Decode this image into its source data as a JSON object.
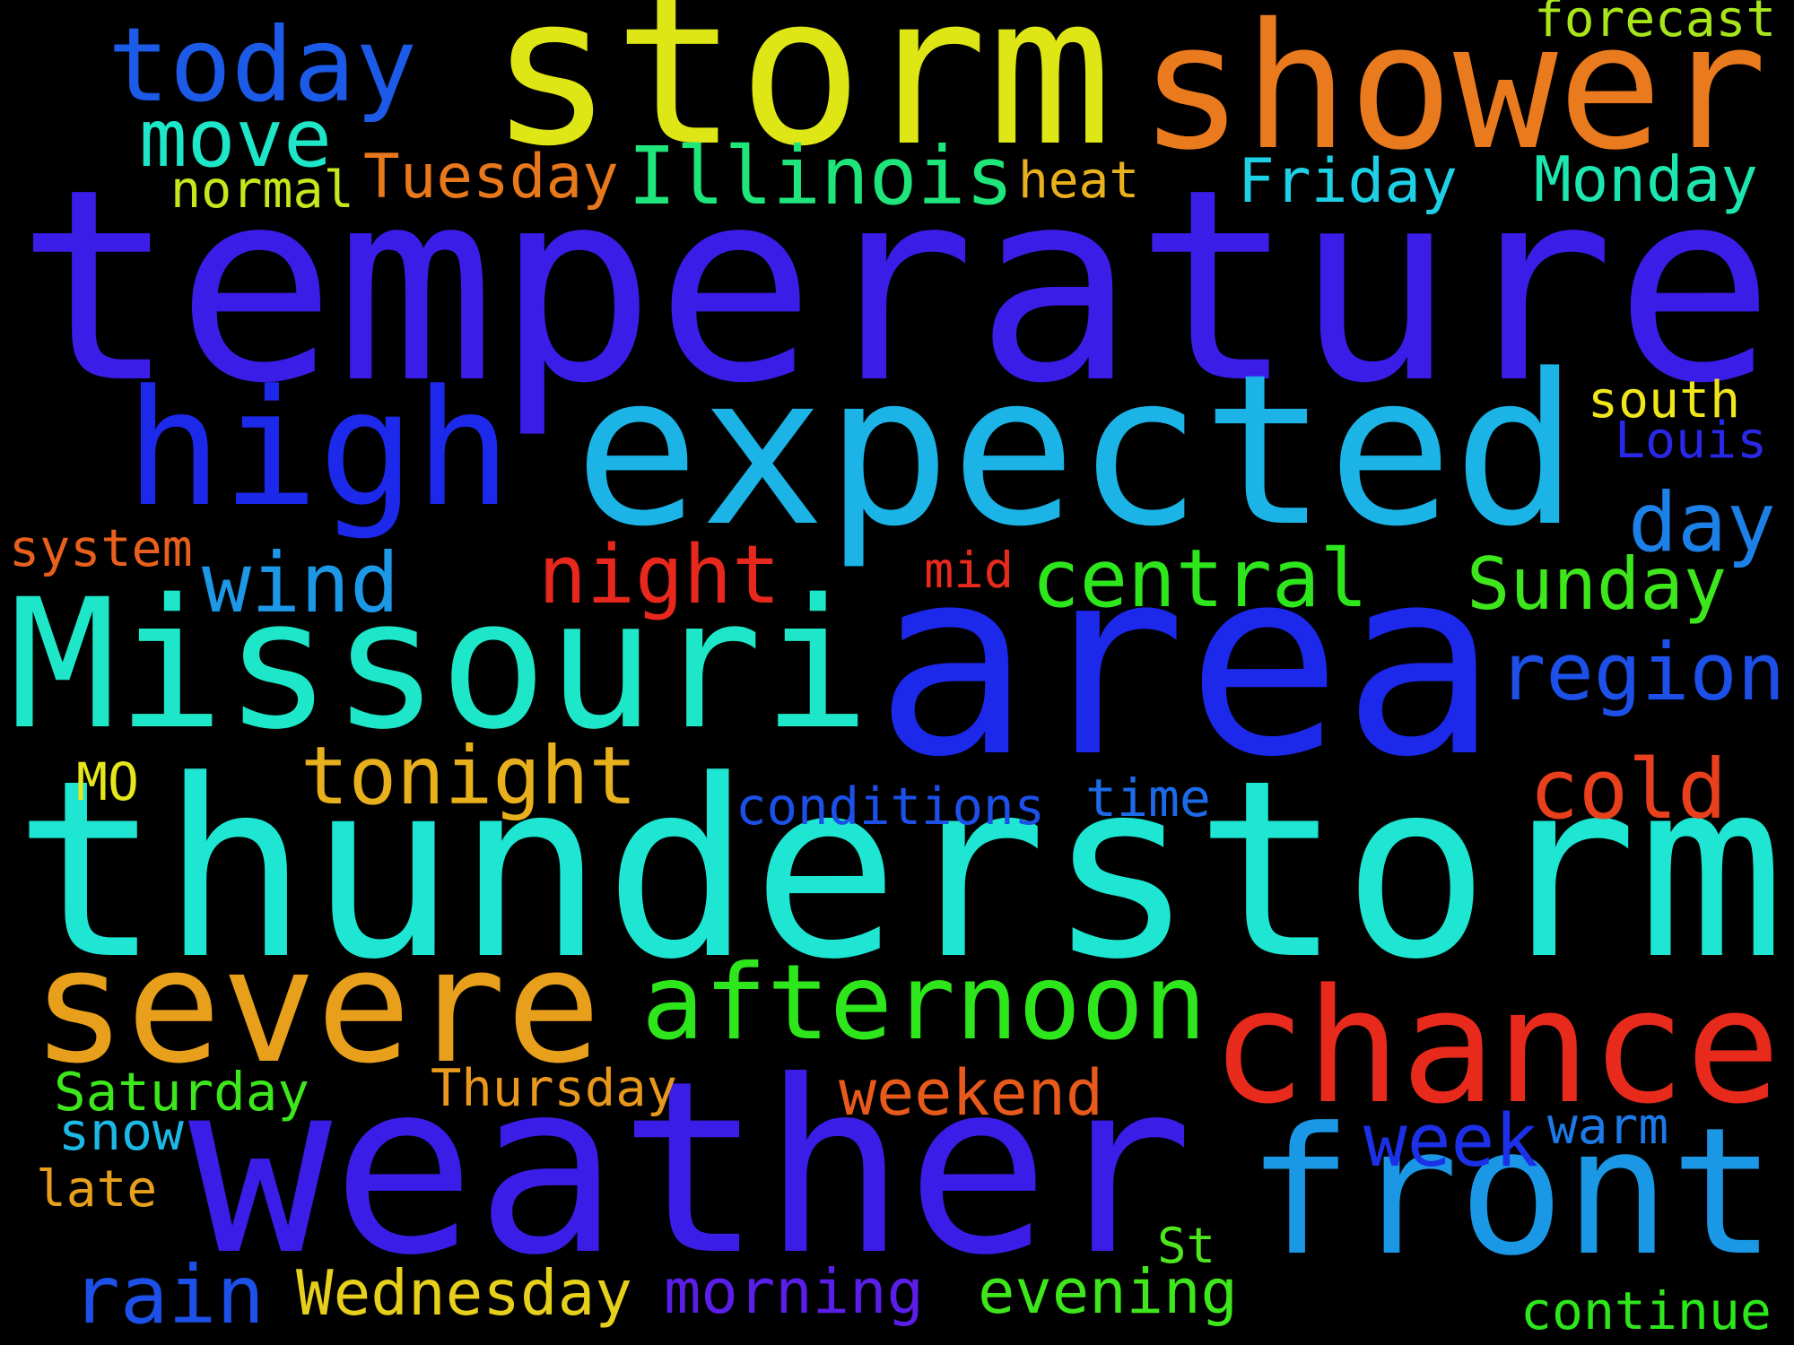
{
  "background": "#000000",
  "words": [
    {
      "text": "temperature",
      "color": "#3a1ee8"
    },
    {
      "text": "thunderstorm",
      "color": "#1ee6d2"
    },
    {
      "text": "weather",
      "color": "#3a1ee8"
    },
    {
      "text": "area",
      "color": "#1c28ea"
    },
    {
      "text": "storm",
      "color": "#dfe616"
    },
    {
      "text": "shower",
      "color": "#ea7a1e"
    },
    {
      "text": "expected",
      "color": "#1cb4e6"
    },
    {
      "text": "Missouri",
      "color": "#1ee6c8"
    },
    {
      "text": "high",
      "color": "#1c28ea"
    },
    {
      "text": "chance",
      "color": "#e82a1c"
    },
    {
      "text": "front",
      "color": "#1a98e6"
    },
    {
      "text": "severe",
      "color": "#e8a01c"
    },
    {
      "text": "afternoon",
      "color": "#2ee61c"
    },
    {
      "text": "today",
      "color": "#1c5ae8"
    },
    {
      "text": "night",
      "color": "#e8281c"
    },
    {
      "text": "central",
      "color": "#2ee61c"
    },
    {
      "text": "tonight",
      "color": "#e8b01c"
    },
    {
      "text": "Illinois",
      "color": "#1ee67a"
    },
    {
      "text": "region",
      "color": "#1c50e8"
    },
    {
      "text": "move",
      "color": "#1ee6c8"
    },
    {
      "text": "Sunday",
      "color": "#3ee61c"
    },
    {
      "text": "cold",
      "color": "#e8401c"
    },
    {
      "text": "day",
      "color": "#1c80e6"
    },
    {
      "text": "wind",
      "color": "#1c98e6"
    },
    {
      "text": "rain",
      "color": "#1c50e8"
    },
    {
      "text": "week",
      "color": "#1c30e8"
    },
    {
      "text": "Wednesday",
      "color": "#e6d01c"
    },
    {
      "text": "weekend",
      "color": "#e85a1c"
    },
    {
      "text": "morning",
      "color": "#5a1ee8"
    },
    {
      "text": "evening",
      "color": "#3ee61c"
    },
    {
      "text": "Tuesday",
      "color": "#e8781c"
    },
    {
      "text": "Friday",
      "color": "#1ed0e6"
    },
    {
      "text": "Monday",
      "color": "#1ee6b0"
    },
    {
      "text": "Saturday",
      "color": "#3ee61c"
    },
    {
      "text": "Thursday",
      "color": "#e8981c"
    },
    {
      "text": "conditions",
      "color": "#1c50e8"
    },
    {
      "text": "time",
      "color": "#1c6ae8"
    },
    {
      "text": "south",
      "color": "#f0e61c"
    },
    {
      "text": "Louis",
      "color": "#2a28e8"
    },
    {
      "text": "system",
      "color": "#e8601c"
    },
    {
      "text": "mid",
      "color": "#e82a1c"
    },
    {
      "text": "forecast",
      "color": "#a8e61c"
    },
    {
      "text": "normal",
      "color": "#c8e61c"
    },
    {
      "text": "heat",
      "color": "#e8b01c"
    },
    {
      "text": "MO",
      "color": "#e6e61c"
    },
    {
      "text": "snow",
      "color": "#1cb8e6"
    },
    {
      "text": "late",
      "color": "#e8a01c"
    },
    {
      "text": "warm",
      "color": "#1c7ae8"
    },
    {
      "text": "St",
      "color": "#4ee61c"
    },
    {
      "text": "continue",
      "color": "#2ee61c"
    }
  ]
}
